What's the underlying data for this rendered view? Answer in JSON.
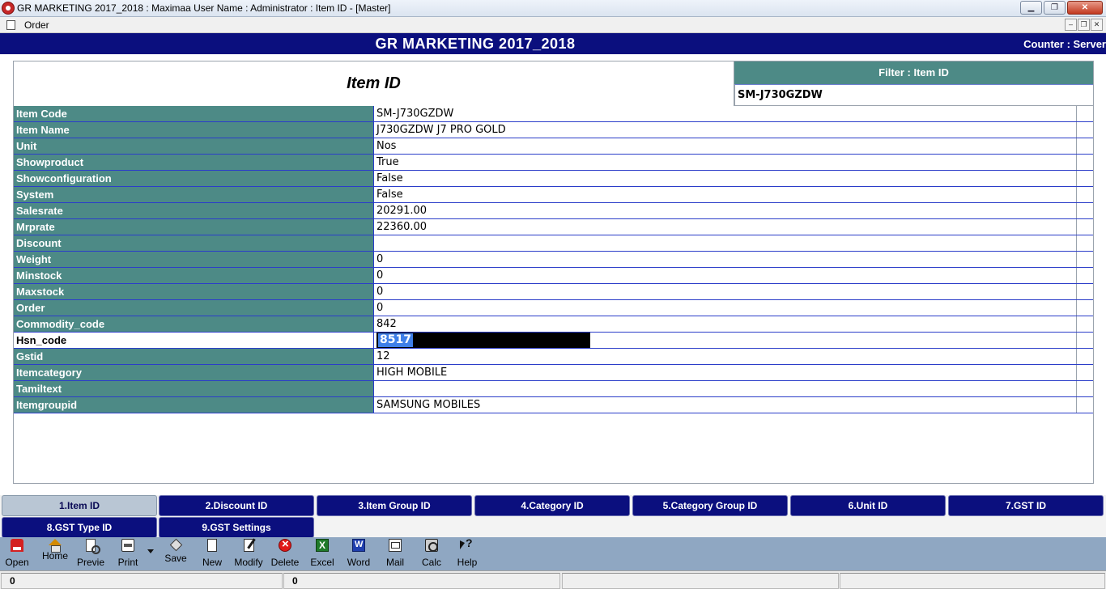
{
  "window": {
    "title": "GR MARKETING 2017_2018 : Maximaa User Name : Administrator : Item ID  - [Master]"
  },
  "menu": {
    "order_label": "Order"
  },
  "header": {
    "title": "GR MARKETING 2017_2018",
    "counter": "Counter : Server"
  },
  "panel": {
    "title": "Item ID",
    "filter_label": "Filter : Item ID",
    "filter_value": "SM-J730GZDW"
  },
  "fields": [
    {
      "label": "Item Code",
      "value": "SM-J730GZDW"
    },
    {
      "label": "Item Name",
      "value": "J730GZDW J7 PRO GOLD"
    },
    {
      "label": "Unit",
      "value": "Nos"
    },
    {
      "label": "Showproduct",
      "value": "True"
    },
    {
      "label": "Showconfiguration",
      "value": "False"
    },
    {
      "label": "System",
      "value": "False"
    },
    {
      "label": "Salesrate",
      "value": "20291.00"
    },
    {
      "label": "Mrprate",
      "value": "22360.00"
    },
    {
      "label": "Discount",
      "value": ""
    },
    {
      "label": "Weight",
      "value": "0"
    },
    {
      "label": "Minstock",
      "value": "0"
    },
    {
      "label": "Maxstock",
      "value": "0"
    },
    {
      "label": "Order",
      "value": "0"
    },
    {
      "label": "Commodity_code",
      "value": "842"
    },
    {
      "label": "Hsn_code",
      "value": "8517"
    },
    {
      "label": "Gstid",
      "value": "12"
    },
    {
      "label": "Itemcategory",
      "value": "HIGH MOBILE"
    },
    {
      "label": "Tamiltext",
      "value": ""
    },
    {
      "label": "Itemgroupid",
      "value": "SAMSUNG MOBILES"
    }
  ],
  "tabs": [
    "1.Item ID",
    "2.Discount ID",
    "3.Item Group ID",
    "4.Category ID",
    "5.Category Group ID",
    "6.Unit ID",
    "7.GST ID",
    "8.GST Type ID",
    "9.GST Settings"
  ],
  "toolbar": [
    {
      "label": "Open",
      "icon": "open-folder-icon"
    },
    {
      "label": "Home",
      "icon": "home-icon"
    },
    {
      "label": "Previe",
      "icon": "preview-icon"
    },
    {
      "label": "Print",
      "icon": "printer-icon"
    },
    {
      "label": "Save",
      "icon": "save-icon"
    },
    {
      "label": "New",
      "icon": "new-document-icon"
    },
    {
      "label": "Modify",
      "icon": "modify-pencil-icon"
    },
    {
      "label": "Delete",
      "icon": "delete-icon"
    },
    {
      "label": "Excel",
      "icon": "excel-icon"
    },
    {
      "label": "Word",
      "icon": "word-icon"
    },
    {
      "label": "Mail",
      "icon": "mail-icon"
    },
    {
      "label": "Calc",
      "icon": "calculator-icon"
    },
    {
      "label": "Help",
      "icon": "help-icon"
    }
  ],
  "status": [
    "0",
    "0",
    "",
    ""
  ],
  "colors": {
    "header_bg": "#0b0f7e",
    "label_bg": "#4d8a86",
    "toolbar_bg": "#8fa7c2",
    "selection": "#3f7fe8"
  }
}
